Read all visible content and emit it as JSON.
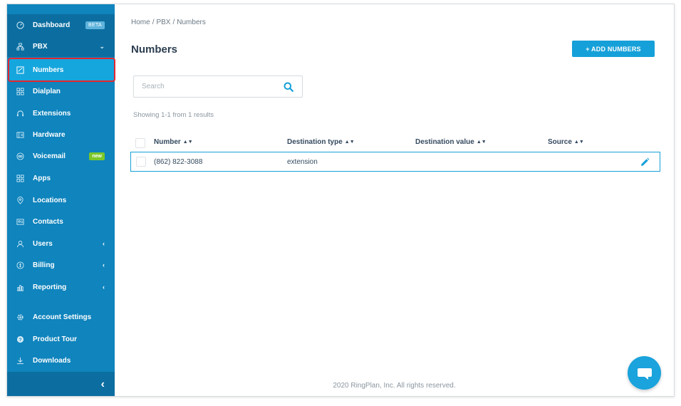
{
  "sidebar": {
    "items": [
      {
        "label": "Dashboard",
        "icon": "dashboard-icon",
        "badge": "BETA"
      },
      {
        "label": "PBX",
        "icon": "pbx-icon",
        "chevron": "down"
      },
      {
        "label": "Numbers",
        "icon": "numbers-icon",
        "active": true
      },
      {
        "label": "Dialplan",
        "icon": "dialplan-icon"
      },
      {
        "label": "Extensions",
        "icon": "headset-icon"
      },
      {
        "label": "Hardware",
        "icon": "hardware-icon"
      },
      {
        "label": "Voicemail",
        "icon": "voicemail-icon",
        "badge": "new"
      },
      {
        "label": "Apps",
        "icon": "apps-icon"
      },
      {
        "label": "Locations",
        "icon": "location-pin-icon"
      },
      {
        "label": "Contacts",
        "icon": "contacts-icon"
      },
      {
        "label": "Users",
        "icon": "user-icon",
        "chevron": "left"
      },
      {
        "label": "Billing",
        "icon": "billing-icon",
        "chevron": "left"
      },
      {
        "label": "Reporting",
        "icon": "reporting-icon",
        "chevron": "left"
      },
      {
        "label": "Account Settings",
        "icon": "gear-icon"
      },
      {
        "label": "Product Tour",
        "icon": "help-icon"
      },
      {
        "label": "Downloads",
        "icon": "download-icon"
      }
    ],
    "collapse_glyph": "‹"
  },
  "breadcrumb": {
    "items": [
      "Home",
      "PBX",
      "Numbers"
    ],
    "separator": "/"
  },
  "page": {
    "title": "Numbers",
    "add_button": "+ ADD NUMBERS"
  },
  "search": {
    "placeholder": "Search",
    "value": ""
  },
  "results": {
    "summary": "Showing 1-1 from 1 results"
  },
  "table": {
    "columns": [
      "Number",
      "Destination type",
      "Destination value",
      "Source"
    ],
    "rows": [
      {
        "number": "(862) 822-3088",
        "destination_type": "extension",
        "destination_value": "",
        "source": ""
      }
    ]
  },
  "footer": {
    "copyright": "2020 RingPlan, Inc. All rights reserved."
  },
  "colors": {
    "sidebar_bg": "#0f84bd",
    "sidebar_active": "#16a6de",
    "accent": "#16a0d9",
    "highlight_outline": "#e5262f",
    "badge_new": "#7cc72a"
  }
}
